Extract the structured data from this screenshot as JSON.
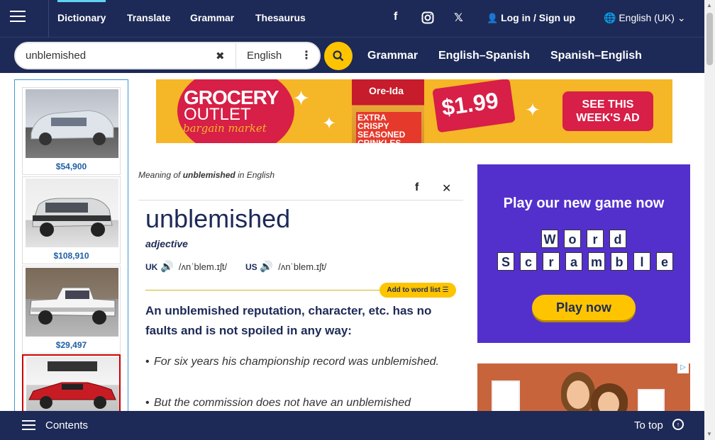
{
  "nav": {
    "items": [
      {
        "label": "Dictionary"
      },
      {
        "label": "Translate"
      },
      {
        "label": "Grammar"
      },
      {
        "label": "Thesaurus"
      }
    ],
    "login": "Log in / Sign up",
    "language": "English (UK)"
  },
  "search": {
    "value": "unblemished",
    "dictionary": "English",
    "links": [
      "Grammar",
      "English–Spanish",
      "Spanish–English"
    ]
  },
  "left_ads": [
    {
      "price": "$54,900"
    },
    {
      "price": "$108,910"
    },
    {
      "price": "$29,497"
    }
  ],
  "banner": {
    "brand_line1": "GROCERY",
    "brand_line2": "OUTLET",
    "brand_tag": "bargain market",
    "product_brand": "Ore-Ida",
    "product_name": "EXTRA CRISPY SEASONED CRINKLES",
    "price": "$1.99",
    "cta": "SEE THIS WEEK'S AD"
  },
  "entry": {
    "meaning_prefix": "Meaning of",
    "word_inline": "unblemished",
    "meaning_suffix": "in English",
    "headword": "unblemished",
    "pos": "adjective",
    "uk_label": "UK",
    "uk_ipa": "/ʌnˈblem.ɪʃt/",
    "us_label": "US",
    "us_ipa": "/ʌnˈblem.ɪʃt/",
    "add_to_list": "Add to word list",
    "definition": "An unblemished reputation, character, etc. has no faults and is not spoiled in any way:",
    "examples": [
      "For six years his championship record was unblemished.",
      "But the commission does not have an unblemished"
    ]
  },
  "game_ad": {
    "title": "Play our new game now",
    "word1": [
      "W",
      "o",
      "r",
      "d"
    ],
    "word2": [
      "S",
      "c",
      "r",
      "a",
      "m",
      "b",
      "l",
      "e"
    ],
    "button": "Play now"
  },
  "bottom": {
    "contents": "Contents",
    "to_top": "To top"
  }
}
